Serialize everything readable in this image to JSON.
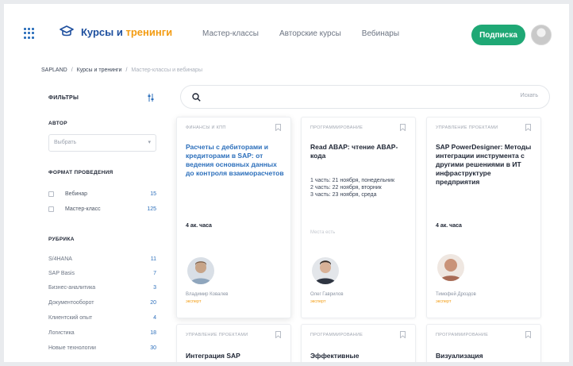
{
  "header": {
    "logo_title": "Курсы и",
    "logo_accent": "тренинги",
    "nav": [
      "Мастер-классы",
      "Авторские курсы",
      "Вебинары"
    ],
    "subscribe_label": "Подписка"
  },
  "breadcrumb": [
    "SAPLAND",
    "Курсы и тренинги",
    "Мастер-классы и вебинары"
  ],
  "search": {
    "placeholder": "",
    "button": "Искать"
  },
  "sidebar": {
    "filters_title": "ФИЛЬТРЫ",
    "author_title": "АВТОР",
    "author_select": "Выбрать",
    "format_title": "ФОРМАТ ПРОВЕДЕНИЯ",
    "formats": [
      {
        "label": "Вебинар",
        "count": "15"
      },
      {
        "label": "Мастер-класс",
        "count": "125"
      }
    ],
    "rubric_title": "РУБРИКА",
    "rubrics": [
      {
        "label": "S/4HANA",
        "count": "11"
      },
      {
        "label": "SAP Basis",
        "count": "7"
      },
      {
        "label": "Бизнес-аналитика",
        "count": "3"
      },
      {
        "label": "Документооборот",
        "count": "20"
      },
      {
        "label": "Клиентский опыт",
        "count": "4"
      },
      {
        "label": "Логистика",
        "count": "18"
      },
      {
        "label": "Новые технологии",
        "count": "30"
      }
    ]
  },
  "cards": [
    {
      "tag": "ФИНАНСЫ И КПП",
      "title": "Расчеты с дебиторами и кредиторами в SAP: от ведения основных данных до контроля взаиморасчетов",
      "duration": "4 ак. часа",
      "author": "Владимир Ковалев",
      "role": "эксперт"
    },
    {
      "tag": "ПРОГРАММИРОВАНИЕ",
      "title": "Read ABAP: чтение ABAP-кода",
      "sub": "1 часть: 21 ноября, понедельник\n2 часть: 22 ноября, вторник\n3 часть: 23 ноября, среда",
      "note": "Места есть",
      "author": "Олег Гаврилов",
      "role": "эксперт"
    },
    {
      "tag": "УПРАВЛЕНИЕ ПРОЕКТАМИ",
      "title": "SAP PowerDesigner: Методы интеграции инструмента с другими решениями в ИТ инфраструктуре предприятия",
      "duration": "4 ак. часа",
      "author": "Тимофей Дроздов",
      "role": "эксперт"
    },
    {
      "tag": "УПРАВЛЕНИЕ ПРОЕКТАМИ",
      "title": "Интеграция SAP"
    },
    {
      "tag": "ПРОГРАММИРОВАНИЕ",
      "title": "Эффективные"
    },
    {
      "tag": "ПРОГРАММИРОВАНИЕ",
      "title": "Визуализация"
    }
  ],
  "colors": {
    "accent": "#1fa875",
    "brand": "#1e4f9e",
    "link": "#2c6fbb",
    "highlight": "#f39c12"
  }
}
